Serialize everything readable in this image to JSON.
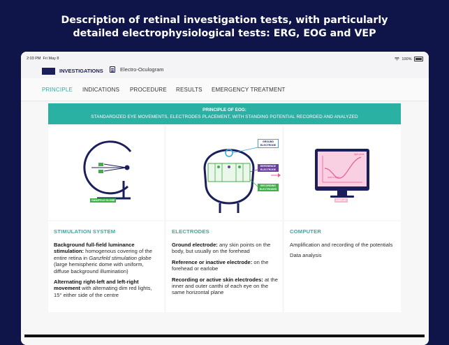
{
  "headline": {
    "line1": "Description of retinal investigation tests, with particularly",
    "line2": "detailed electrophysiological tests: ERG, EOG and VEP"
  },
  "status_bar": {
    "time": "2:03 PM",
    "date": "Fri May 8",
    "battery": "100%"
  },
  "toolbar": {
    "investigations_label": "INVESTIGATIONS",
    "page_label": "Electro-Oculogram"
  },
  "tabs": [
    {
      "label": "PRINCIPLE",
      "active": true
    },
    {
      "label": "INDICATIONS",
      "active": false
    },
    {
      "label": "PROCEDURE",
      "active": false
    },
    {
      "label": "RESULTS",
      "active": false
    },
    {
      "label": "EMERGENCY TREATMENT",
      "active": false
    }
  ],
  "banner": {
    "title": "PRINCIPLE OF EOG:",
    "subtitle": "STANDARDIZED EYE MOVEMENTS, ELECTRODES PLACEMENT, WITH STANDING POTENTIAL RECORDED AND ANALYZED"
  },
  "illustrations": {
    "ganzfeld_label": "GANZFELD GLOBE",
    "ground_label": "GROUND ELECTRODE",
    "reference_label": "REFERENCE ELECTRODE",
    "recording_label": "RECORDING ELECTRODES",
    "display_label": "DISPLAY",
    "light_peak": "light peak",
    "dark_trough": "dark trough"
  },
  "columns": {
    "stimulation": {
      "title": "STIMULATION SYSTEM",
      "p1_bold": "Background full-field luminance stimulation:",
      "p1_text1": " homogenous covering of the entire retina in ",
      "p1_italic": "Ganzfeld stimulation globe",
      "p1_text2": " (large hemispheric dome with uniform, diffuse background illumination)",
      "p2_bold": "Alternating right-left and left-right movement",
      "p2_text": " with alternating dim red lights, 15° either side of the centre"
    },
    "electrodes": {
      "title": "ELECTRODES",
      "p1_bold": "Ground electrode:",
      "p1_text": " any skin points on the body, but usually on the forehead",
      "p2_bold": "Reference or inactive electrode:",
      "p2_text": " on the forehead or earlobe",
      "p3_bold": "Recording or active skin electrodes:",
      "p3_text": " at the inner and outer canthi of each eye on the same horizontal plane"
    },
    "computer": {
      "title": "COMPUTER",
      "p1": "Amplification and recording of the potentials",
      "p2": "Data analysis"
    }
  },
  "colors": {
    "background": "#0f1548",
    "accent": "#2bb0a4",
    "navy": "#1a1f5c",
    "ground_electrode": "#3aa6e0",
    "reference_electrode": "#6a3fa0",
    "recording_electrode": "#3db04a",
    "display": "#e85a96"
  }
}
